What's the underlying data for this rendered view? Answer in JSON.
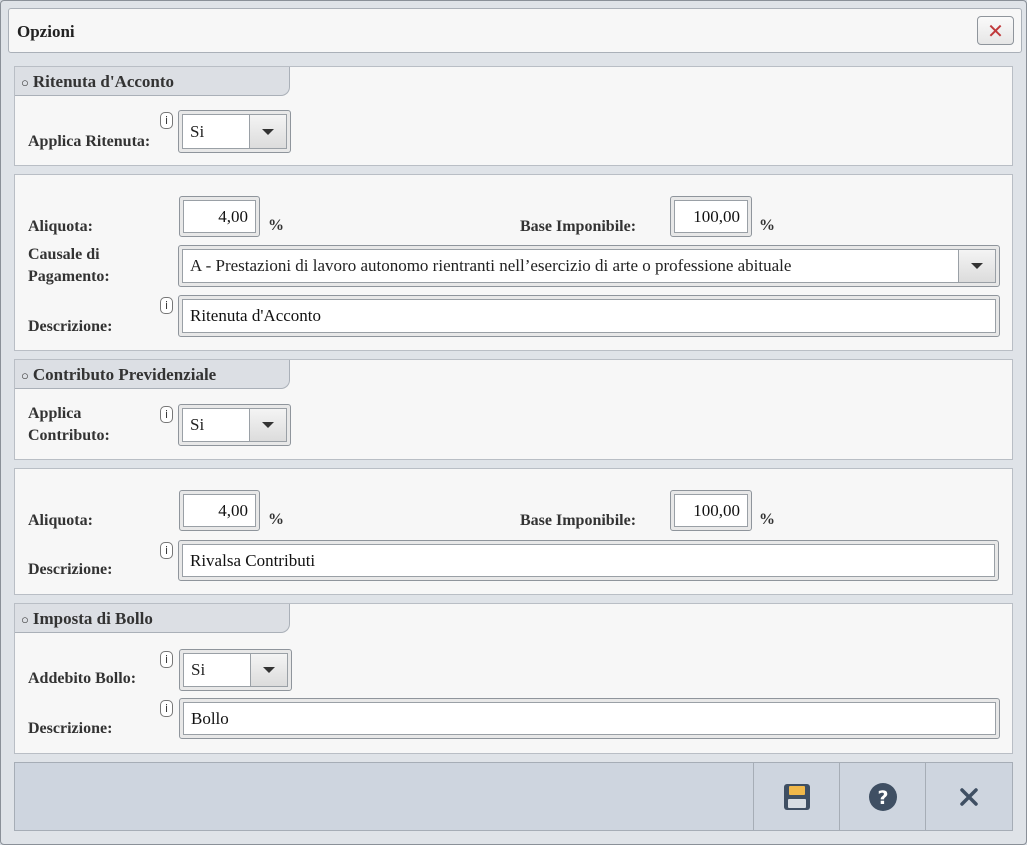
{
  "dialog": {
    "title": "Opzioni",
    "close_glyph": "✕"
  },
  "ritenuta": {
    "section_title": "Ritenuta d'Acconto",
    "applica_label": "Applica Ritenuta:",
    "applica_value": "Si",
    "aliquota_label": "Aliquota:",
    "aliquota_value": "4,00",
    "percent": "%",
    "base_label": "Base Imponibile:",
    "base_value": "100,00",
    "causale_label_1": "Causale di",
    "causale_label_2": "Pagamento:",
    "causale_value": "A - Prestazioni di lavoro autonomo rientranti nell’esercizio di arte o professione abituale",
    "descrizione_label": "Descrizione:",
    "descrizione_value": "Ritenuta d'Acconto"
  },
  "contributo": {
    "section_title": "Contributo Previdenziale",
    "applica_label_1": "Applica",
    "applica_label_2": "Contributo:",
    "applica_value": "Si",
    "aliquota_label": "Aliquota:",
    "aliquota_value": "4,00",
    "percent": "%",
    "base_label": "Base Imponibile:",
    "base_value": "100,00",
    "descrizione_label": "Descrizione:",
    "descrizione_value": "Rivalsa Contributi"
  },
  "bollo": {
    "section_title": "Imposta di Bollo",
    "addebito_label": "Addebito Bollo:",
    "addebito_value": "Si",
    "descrizione_label": "Descrizione:",
    "descrizione_value": "Bollo"
  },
  "info_glyph": "i",
  "bullet": "○",
  "footer": {
    "icons": [
      "save-icon",
      "help-icon",
      "close-icon"
    ]
  },
  "colors": {
    "accent_close": "#c0393b",
    "icon_dark": "#3f4f63",
    "save_top": "#f0b84a"
  }
}
